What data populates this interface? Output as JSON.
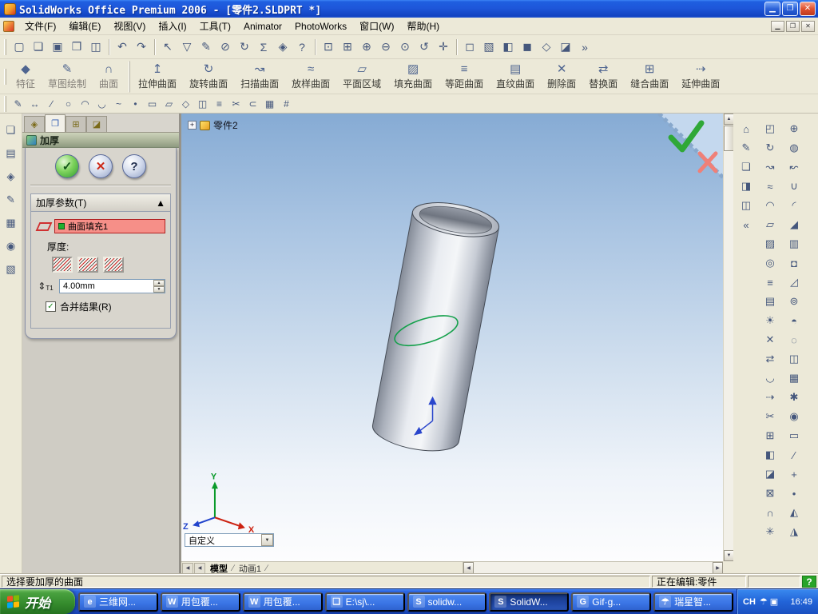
{
  "titlebar": {
    "title": "SolidWorks Office Premium 2006 - [零件2.SLDPRT *]",
    "minimize_glyph": "▁",
    "restore_glyph": "❐",
    "close_glyph": "✕"
  },
  "menubar": {
    "items": [
      "文件(F)",
      "编辑(E)",
      "视图(V)",
      "插入(I)",
      "工具(T)",
      "Animator",
      "PhotoWorks",
      "窗口(W)",
      "帮助(H)"
    ],
    "doc_minimize_glyph": "▁",
    "doc_restore_glyph": "❐",
    "doc_close_glyph": "✕"
  },
  "toolbar_main": {
    "file_icons": [
      {
        "name": "new-file-icon",
        "glyph": "▢"
      },
      {
        "name": "open-icon",
        "glyph": "❏"
      },
      {
        "name": "save-icon",
        "glyph": "▣"
      },
      {
        "name": "print-icon",
        "glyph": "❒"
      },
      {
        "name": "print-preview-icon",
        "glyph": "◫"
      }
    ],
    "edit_icons": [
      {
        "name": "undo-icon",
        "glyph": "↶"
      },
      {
        "name": "redo-icon",
        "glyph": "↷"
      }
    ],
    "tool_icons": [
      {
        "name": "select-icon",
        "glyph": "↖"
      },
      {
        "name": "selection-filter-icon",
        "glyph": "▽"
      },
      {
        "name": "sketch-icon",
        "glyph": "✎"
      },
      {
        "name": "dimension-icon",
        "glyph": "⊘"
      },
      {
        "name": "rebuild-icon",
        "glyph": "↻"
      },
      {
        "name": "equations-icon",
        "glyph": "Σ"
      },
      {
        "name": "edit-color-icon",
        "glyph": "◈"
      },
      {
        "name": "help-icon",
        "glyph": "?"
      }
    ],
    "view_icons": [
      {
        "name": "zoom-fit-icon",
        "glyph": "⊡"
      },
      {
        "name": "zoom-area-icon",
        "glyph": "⊞"
      },
      {
        "name": "zoom-in-icon",
        "glyph": "⊕"
      },
      {
        "name": "zoom-out-icon",
        "glyph": "⊖"
      },
      {
        "name": "zoom-selection-icon",
        "glyph": "⊙"
      },
      {
        "name": "rotate-view-icon",
        "glyph": "↺"
      },
      {
        "name": "pan-icon",
        "glyph": "✛"
      }
    ],
    "display_icons": [
      {
        "name": "wireframe-icon",
        "glyph": "◻"
      },
      {
        "name": "hidden-lines-icon",
        "glyph": "▧"
      },
      {
        "name": "shaded-with-edges-icon",
        "glyph": "◧"
      },
      {
        "name": "shaded-icon",
        "glyph": "◼"
      },
      {
        "name": "perspective-icon",
        "glyph": "◇"
      },
      {
        "name": "section-view-icon",
        "glyph": "◪"
      },
      {
        "name": "toolbar-overflow-icon",
        "glyph": "»"
      }
    ]
  },
  "command_bar": {
    "buttons": [
      {
        "name": "features-button",
        "label": "特征",
        "glyph": "◆"
      },
      {
        "name": "sketch-button",
        "label": "草图绘制",
        "glyph": "✎"
      },
      {
        "name": "surfaces-button",
        "label": "曲面",
        "glyph": "∩"
      },
      {
        "name": "extruded-surface-button",
        "label": "拉伸曲面",
        "glyph": "↥"
      },
      {
        "name": "revolved-surface-button",
        "label": "旋转曲面",
        "glyph": "↻"
      },
      {
        "name": "swept-surface-button",
        "label": "扫描曲面",
        "glyph": "↝"
      },
      {
        "name": "lofted-surface-button",
        "label": "放样曲面",
        "glyph": "≈"
      },
      {
        "name": "planar-surface-button",
        "label": "平面区域",
        "glyph": "▱"
      },
      {
        "name": "filled-surface-button",
        "label": "填充曲面",
        "glyph": "▨"
      },
      {
        "name": "offset-surface-button",
        "label": "等距曲面",
        "glyph": "≡"
      },
      {
        "name": "ruled-surface-button",
        "label": "直纹曲面",
        "glyph": "▤"
      },
      {
        "name": "delete-face-button",
        "label": "删除面",
        "glyph": "✕"
      },
      {
        "name": "replace-face-button",
        "label": "替换面",
        "glyph": "⇄"
      },
      {
        "name": "knit-surface-button",
        "label": "缝合曲面",
        "glyph": "⊞"
      },
      {
        "name": "extend-surface-button",
        "label": "延伸曲面",
        "glyph": "⇢"
      }
    ]
  },
  "sketch_bar": {
    "icons": [
      {
        "name": "sketch-tool-icon",
        "glyph": "✎"
      },
      {
        "name": "smart-dimension-icon",
        "glyph": "↔"
      },
      {
        "name": "line-icon",
        "glyph": "∕"
      },
      {
        "name": "circle-icon",
        "glyph": "○"
      },
      {
        "name": "centerpoint-arc-icon",
        "glyph": "◠"
      },
      {
        "name": "tangent-arc-icon",
        "glyph": "◡"
      },
      {
        "name": "spline-icon",
        "glyph": "~"
      },
      {
        "name": "point-icon",
        "glyph": "•"
      },
      {
        "name": "rectangle-icon",
        "glyph": "▭"
      },
      {
        "name": "parallelogram-icon",
        "glyph": "▱"
      },
      {
        "name": "polygon-icon",
        "glyph": "◇"
      },
      {
        "name": "mirror-entities-icon",
        "glyph": "◫"
      },
      {
        "name": "offset-entities-icon",
        "glyph": "≡"
      },
      {
        "name": "trim-entities-icon",
        "glyph": "✂"
      },
      {
        "name": "convert-entities-icon",
        "glyph": "⊂"
      },
      {
        "name": "linear-sketch-pattern-icon",
        "glyph": "▦"
      },
      {
        "name": "grid-icon",
        "glyph": "#"
      }
    ]
  },
  "left_strip": {
    "icons": [
      {
        "name": "document-tool-icon",
        "glyph": "❏"
      },
      {
        "name": "annotations-icon",
        "glyph": "▤"
      },
      {
        "name": "reference-geometry-icon",
        "glyph": "◈"
      },
      {
        "name": "sketch-entities-icon",
        "glyph": "✎"
      },
      {
        "name": "grid-tool-icon",
        "glyph": "▦"
      },
      {
        "name": "origin-tool-icon",
        "glyph": "◉"
      },
      {
        "name": "section-tool-icon",
        "glyph": "▧"
      }
    ]
  },
  "property_manager": {
    "tabs": [
      {
        "name": "featuremanager-tab",
        "glyph": "◈"
      },
      {
        "name": "propertymanager-tab",
        "glyph": "❐",
        "active": true
      },
      {
        "name": "configurationmanager-tab",
        "glyph": "⊞"
      },
      {
        "name": "addins-tab",
        "glyph": "◪"
      }
    ],
    "title": "加厚",
    "ok_glyph": "✓",
    "cancel_glyph": "✕",
    "help_glyph": "?",
    "params_group": {
      "title": "加厚参数(T)",
      "collapse_glyph": "▲",
      "selection_value": "曲面填充1",
      "thickness_label": "厚度:",
      "t1_glyph": "⇕",
      "t1_label": "T1",
      "thickness_value": "4.00mm",
      "merge_checkbox_label": "合并结果(R)",
      "checkbox_glyph": "✓"
    }
  },
  "viewport": {
    "tree_node_label": "零件2",
    "view_combo_value": "自定义",
    "tabs": {
      "model": "模型",
      "animation": "动画1"
    },
    "axis_labels": {
      "x": "X",
      "y": "Y",
      "z": "Z"
    }
  },
  "right_dock": {
    "col1": [
      {
        "name": "view-orientation-icon",
        "glyph": "⌂"
      },
      {
        "name": "edit-sketch-icon",
        "glyph": "✎"
      },
      {
        "name": "document-icon",
        "glyph": "❏"
      },
      {
        "name": "appearance-icon",
        "glyph": "◨"
      },
      {
        "name": "display-style-icon",
        "glyph": "◫"
      },
      {
        "name": "collapse-upper-chevron-icon",
        "glyph": "«"
      }
    ],
    "collapse_lower_glyph": "«",
    "col2": [
      {
        "name": "extruded-surface-icon",
        "glyph": "◰"
      },
      {
        "name": "revolved-surface-icon",
        "glyph": "↻"
      },
      {
        "name": "swept-surface-icon",
        "glyph": "↝"
      },
      {
        "name": "lofted-surface-icon",
        "glyph": "≈"
      },
      {
        "name": "boundary-surface-icon",
        "glyph": "◠"
      },
      {
        "name": "planar-surface-icon",
        "glyph": "▱"
      },
      {
        "name": "filled-surface-icon",
        "glyph": "▨"
      },
      {
        "name": "freeform-icon",
        "glyph": "◎"
      },
      {
        "name": "offset-surface-icon",
        "glyph": "≡"
      },
      {
        "name": "ruled-surface-icon",
        "glyph": "▤"
      },
      {
        "name": "radiate-surface-icon",
        "glyph": "☀"
      },
      {
        "name": "delete-face-icon",
        "glyph": "✕"
      },
      {
        "name": "replace-face-icon",
        "glyph": "⇄"
      },
      {
        "name": "untrim-surface-icon",
        "glyph": "◡"
      },
      {
        "name": "extend-surface-icon",
        "glyph": "⇢"
      },
      {
        "name": "trim-surface-icon",
        "glyph": "✂"
      },
      {
        "name": "knit-surface-icon",
        "glyph": "⊞"
      },
      {
        "name": "thicken-tool-icon",
        "glyph": "◧"
      },
      {
        "name": "thickened-cut-icon",
        "glyph": "◪"
      },
      {
        "name": "cut-with-surface-icon",
        "glyph": "⊠"
      },
      {
        "name": "mid-surface-icon",
        "glyph": "∩"
      },
      {
        "name": "parting-surface-icon",
        "glyph": "✳"
      }
    ],
    "col3": [
      {
        "name": "extrude-boss-icon",
        "glyph": "⊕"
      },
      {
        "name": "revolve-boss-icon",
        "glyph": "◍"
      },
      {
        "name": "sweep-boss-icon",
        "glyph": "↜"
      },
      {
        "name": "loft-boss-icon",
        "glyph": "∪"
      },
      {
        "name": "fillet-icon",
        "glyph": "◜"
      },
      {
        "name": "chamfer-icon",
        "glyph": "◢"
      },
      {
        "name": "rib-icon",
        "glyph": "▥"
      },
      {
        "name": "shell-icon",
        "glyph": "◘"
      },
      {
        "name": "draft-icon",
        "glyph": "◿"
      },
      {
        "name": "hole-wizard-icon",
        "glyph": "⊚"
      },
      {
        "name": "dome-icon",
        "glyph": "◓"
      },
      {
        "name": "wrap-icon",
        "glyph": "◌"
      },
      {
        "name": "mirror-feature-icon",
        "glyph": "◫"
      },
      {
        "name": "linear-pattern-icon",
        "glyph": "▦"
      },
      {
        "name": "circular-pattern-icon",
        "glyph": "✱"
      },
      {
        "name": "curve-pattern-icon",
        "glyph": "◉"
      },
      {
        "name": "reference-plane-icon",
        "glyph": "▭"
      },
      {
        "name": "reference-axis-icon",
        "glyph": "∕"
      },
      {
        "name": "coordinate-system-icon",
        "glyph": "+"
      },
      {
        "name": "reference-point-icon",
        "glyph": "•"
      },
      {
        "name": "split-line-icon",
        "glyph": "◭"
      },
      {
        "name": "instant3d-icon",
        "glyph": "◮"
      }
    ]
  },
  "statusbar": {
    "message": "选择要加厚的曲面",
    "editing_label": "正在编辑:零件",
    "help_glyph": "?"
  },
  "taskbar": {
    "start_label": "开始",
    "tasks": [
      {
        "name": "task-browser-1",
        "label": "三维网...",
        "glyph": "e"
      },
      {
        "name": "task-doc-1",
        "label": "用包覆...",
        "glyph": "W"
      },
      {
        "name": "task-doc-2",
        "label": "用包覆...",
        "glyph": "W"
      },
      {
        "name": "task-explorer",
        "label": "E:\\sj\\...",
        "glyph": "❏"
      },
      {
        "name": "task-solidworks-1",
        "label": "solidw...",
        "glyph": "S"
      },
      {
        "name": "task-solidworks-2",
        "label": "SolidW...",
        "glyph": "S",
        "active": true
      },
      {
        "name": "task-gif-editor",
        "label": "Gif·g...",
        "glyph": "G"
      },
      {
        "name": "task-antivirus",
        "label": "瑞星智...",
        "glyph": "☂"
      }
    ],
    "tray": {
      "lang": "CH",
      "icons": [
        {
          "name": "tray-antivirus-icon",
          "glyph": "☂"
        },
        {
          "name": "tray-display-icon",
          "glyph": "▣"
        }
      ],
      "time": "16:49"
    }
  },
  "glyphs": {
    "scroll_up": "▲",
    "scroll_down": "▼",
    "scroll_left": "◀",
    "scroll_right": "▶",
    "dropdown": "▼",
    "spin_up": "▲",
    "spin_down": "▼",
    "tab_sep": "∕",
    "tree_expand": "+"
  },
  "colors": {
    "selection_highlight": "#f68f88",
    "sketch_green": "#13a04a",
    "viewport_top": "#86abd4",
    "taskbar_blue": "#2459d8"
  }
}
